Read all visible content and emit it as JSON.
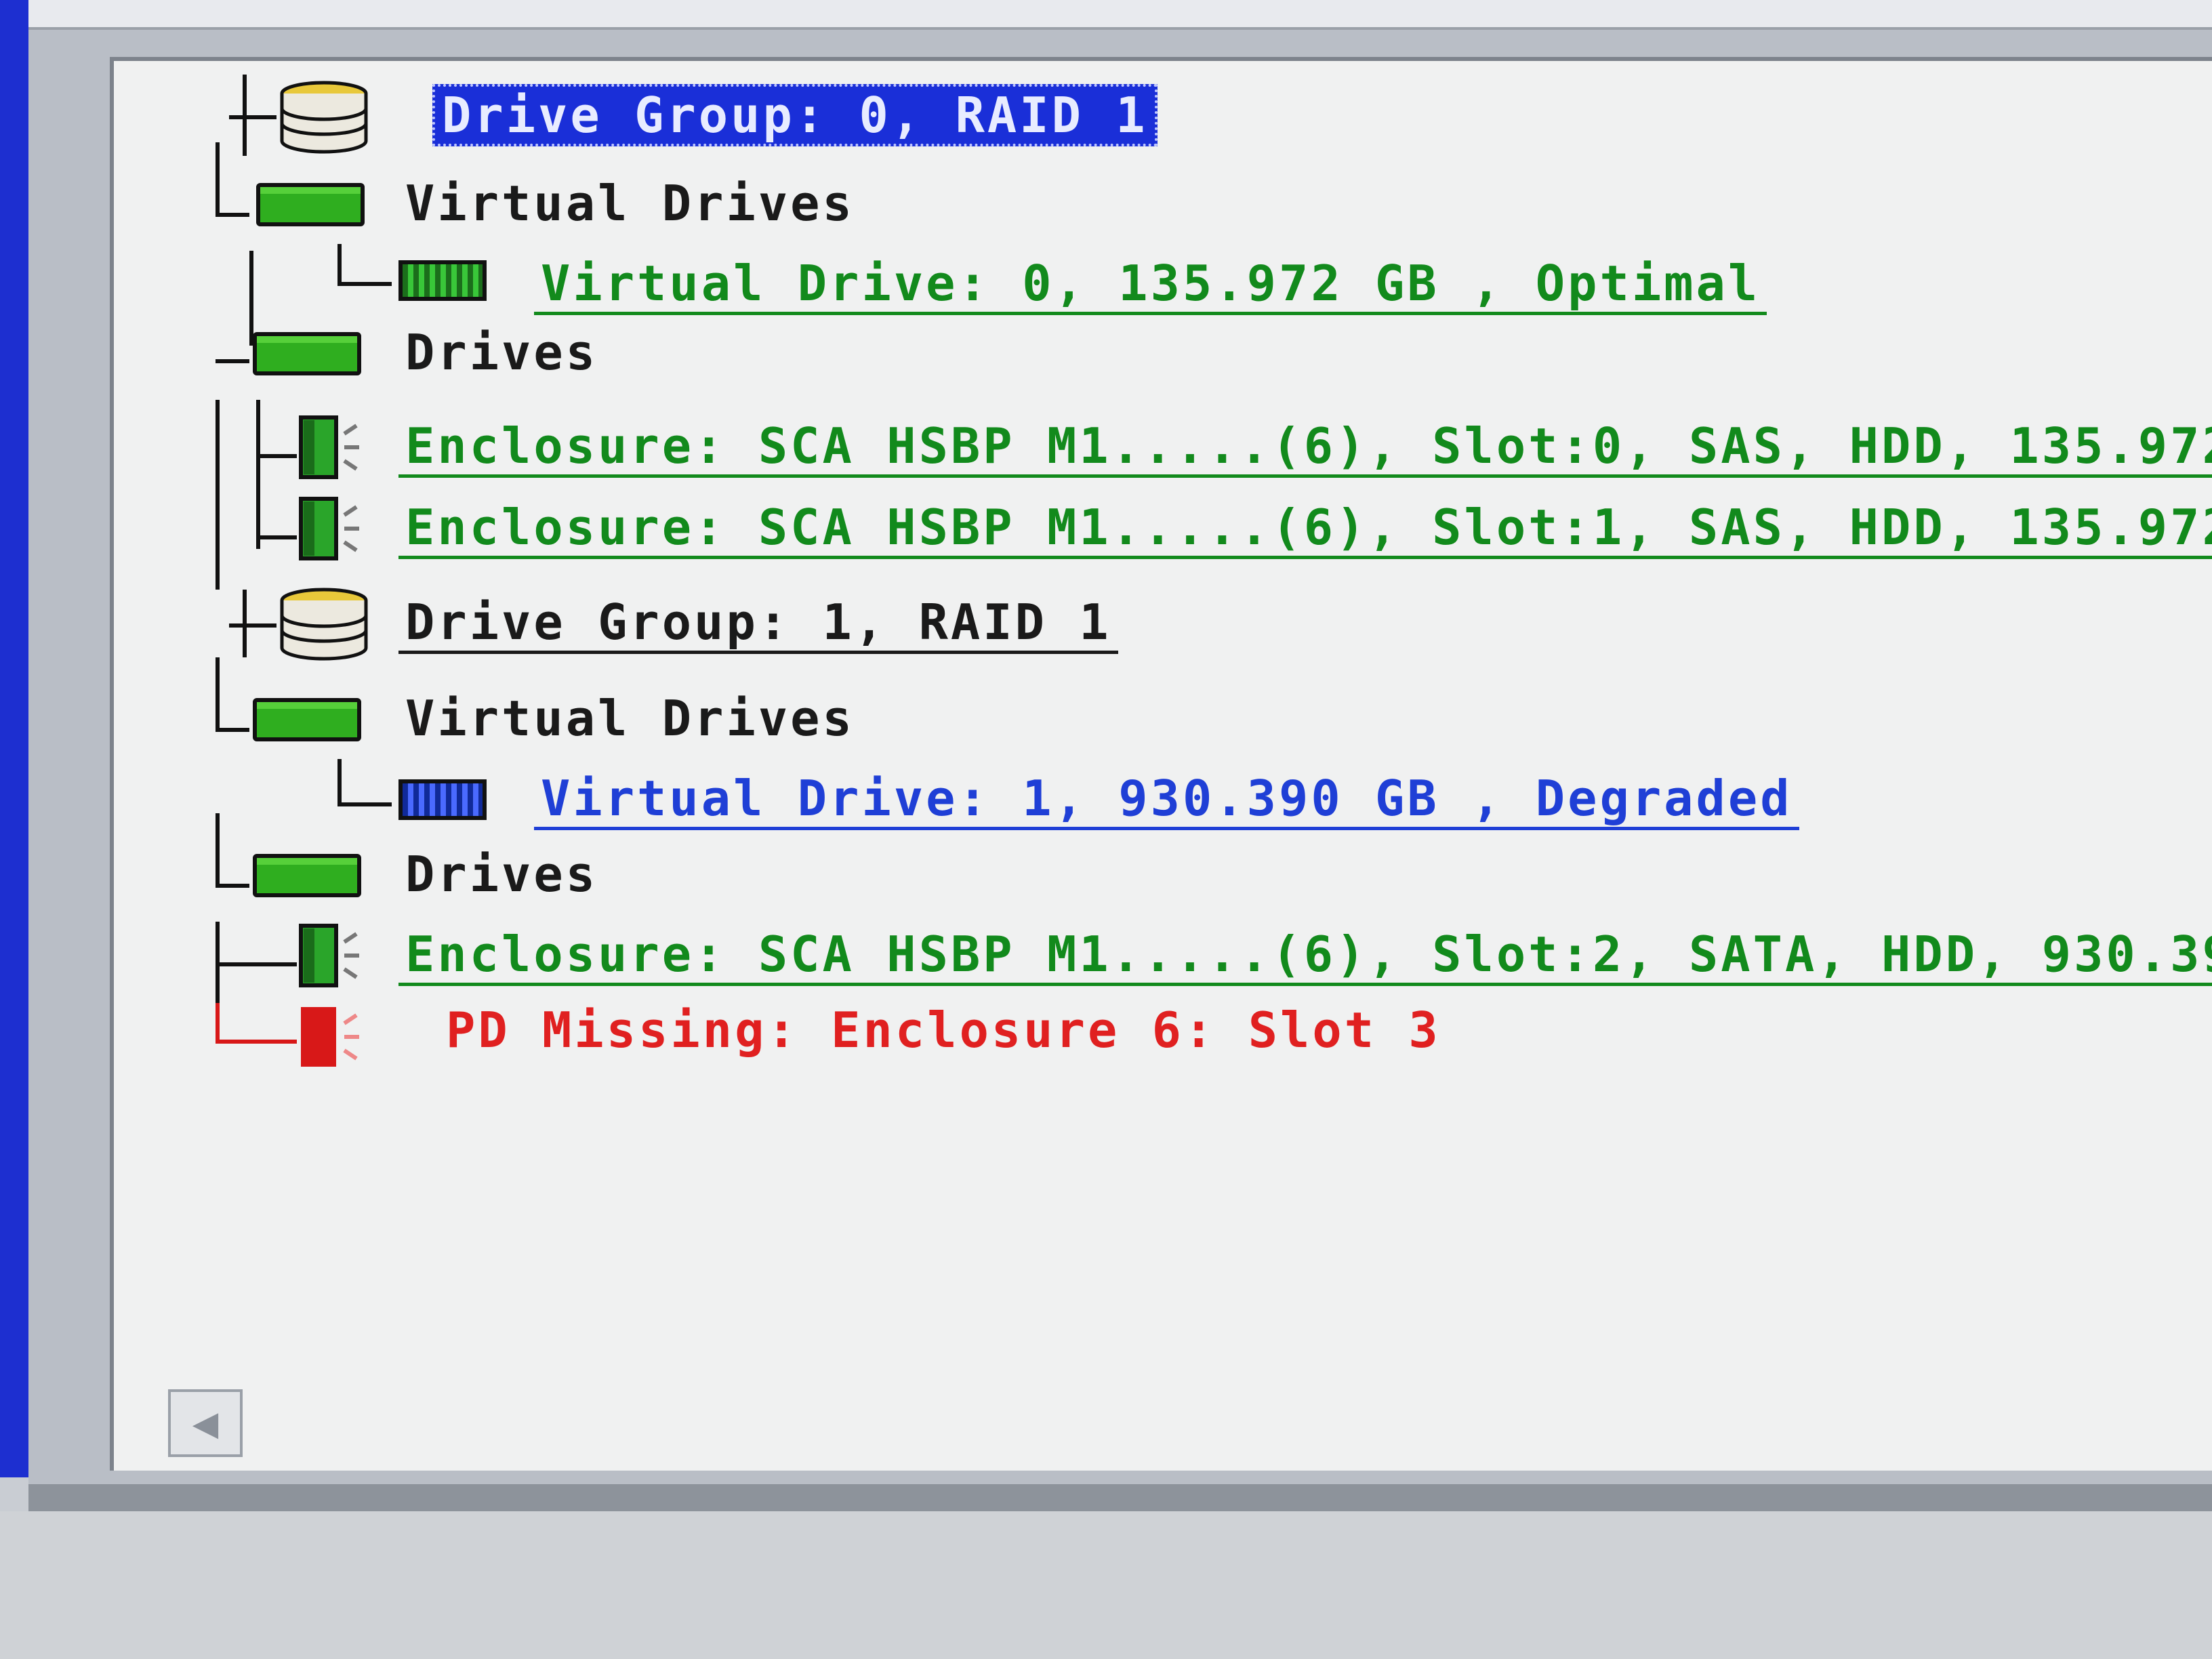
{
  "tree": {
    "items": [
      {
        "label": "Drive Group: 0, RAID 1",
        "style": "selected"
      },
      {
        "label": "Virtual Drives",
        "style": "normal"
      },
      {
        "label": "Virtual Drive: 0, 135.972 GB , Optimal",
        "style": "green"
      },
      {
        "label": "Drives",
        "style": "normal"
      },
      {
        "label": "Enclosure: SCA HSBP M1.....(6), Slot:0, SAS, HDD, 135.972",
        "style": "green"
      },
      {
        "label": "Enclosure: SCA HSBP M1.....(6), Slot:1, SAS, HDD, 135.972",
        "style": "green"
      },
      {
        "label": "Drive Group: 1, RAID 1",
        "style": "normal"
      },
      {
        "label": "Virtual Drives",
        "style": "normal"
      },
      {
        "label": "Virtual Drive: 1, 930.390 GB , Degraded",
        "style": "blue"
      },
      {
        "label": "Drives",
        "style": "normal"
      },
      {
        "label": "Enclosure: SCA HSBP M1.....(6), Slot:2, SATA, HDD, 930.39",
        "style": "green"
      },
      {
        "label": "PD Missing: Enclosure 6: Slot 3",
        "style": "red"
      }
    ]
  },
  "colors": {
    "selection": "#1a2fd8",
    "optimal": "#128a1c",
    "degraded": "#1f3fd6",
    "missing": "#e02020",
    "folder": "#2fae1f",
    "drive_group": "#e8c83a"
  },
  "icons": {
    "drive_group": "disk-stack-icon",
    "folder": "folder-icon",
    "virtual_drive": "virtual-drive-icon",
    "physical_drive": "physical-drive-icon",
    "missing_drive": "missing-drive-icon",
    "scroll": "scroll-left-icon"
  },
  "scrollbar": {
    "left_glyph": "◀"
  }
}
